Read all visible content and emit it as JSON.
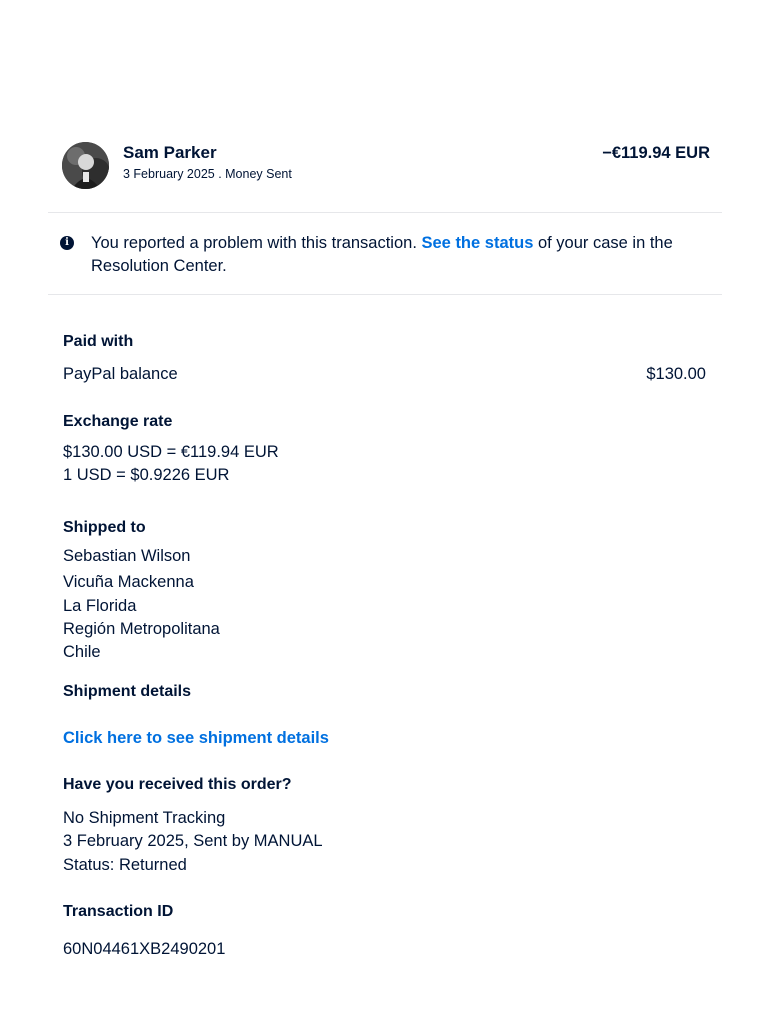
{
  "header": {
    "name": "Sam Parker",
    "meta": "3 February 2025 . Money Sent",
    "amount": "−€119.94 EUR"
  },
  "notice": {
    "text_before": "You reported a problem with this transaction. ",
    "link_text": "See the status",
    "text_after": " of your case in the Resolution Center.",
    "icon": "info-icon"
  },
  "paid_with": {
    "label": "Paid with",
    "method": "PayPal balance",
    "amount": "$130.00"
  },
  "exchange_rate": {
    "label": "Exchange rate",
    "line1": "$130.00 USD = €119.94 EUR",
    "line2": "1 USD = $0.9226 EUR"
  },
  "shipped_to": {
    "label": "Shipped to",
    "lines": [
      "Sebastian Wilson",
      "Vicuña Mackenna",
      "La Florida",
      "Región Metropolitana",
      "Chile"
    ]
  },
  "shipment_details": {
    "label": "Shipment details",
    "link_text": "Click here to see shipment details"
  },
  "received": {
    "label": "Have you received this order?",
    "lines": [
      "No Shipment Tracking",
      "3 February 2025, Sent by MANUAL",
      "Status: Returned"
    ]
  },
  "transaction": {
    "label": "Transaction ID",
    "id": "60N04461XB2490201"
  },
  "colors": {
    "text": "#001435",
    "link": "#0070e0",
    "divider": "#e6e7ea"
  }
}
